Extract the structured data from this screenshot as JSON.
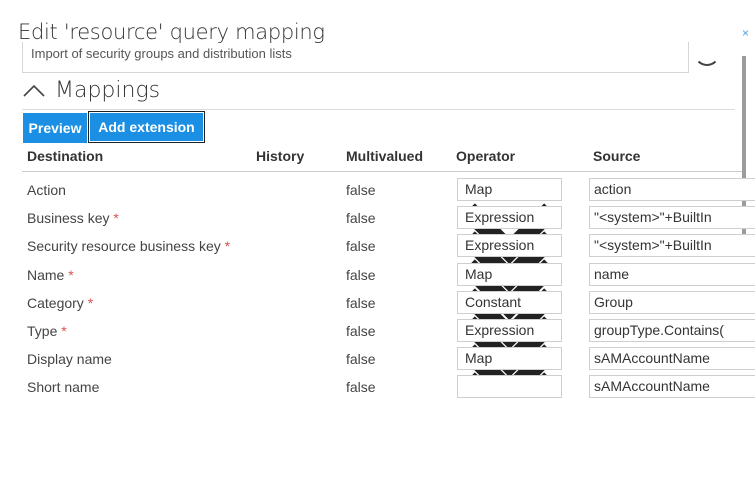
{
  "dialog": {
    "title": "Edit 'resource' query mapping",
    "close_glyph": "×",
    "description": "Import of security groups and distribution lists"
  },
  "section": {
    "title": "Mappings",
    "expanded": true
  },
  "toolbar": {
    "preview_label": "Preview",
    "add_extension_label": "Add extension"
  },
  "table": {
    "headers": {
      "destination": "Destination",
      "history": "History",
      "multivalued": "Multivalued",
      "operator": "Operator",
      "source": "Source"
    },
    "rows": [
      {
        "destination": "Action",
        "required": false,
        "multivalued": "false",
        "operator": "Map",
        "source": "action"
      },
      {
        "destination": "Business key",
        "required": true,
        "multivalued": "false",
        "operator": "Expression",
        "source": "\"<system>\"+BuiltIn"
      },
      {
        "destination": "Security resource business key",
        "required": true,
        "multivalued": "false",
        "operator": "Expression",
        "source": "\"<system>\"+BuiltIn"
      },
      {
        "destination": "Name",
        "required": true,
        "multivalued": "false",
        "operator": "Map",
        "source": "name"
      },
      {
        "destination": "Category",
        "required": true,
        "multivalued": "false",
        "operator": "Constant",
        "source": "Group"
      },
      {
        "destination": "Type",
        "required": true,
        "multivalued": "false",
        "operator": "Expression",
        "source": "groupType.Contains("
      },
      {
        "destination": "Display name",
        "required": false,
        "multivalued": "false",
        "operator": "Map",
        "source": "sAMAccountName"
      },
      {
        "destination": "Short name",
        "required": false,
        "multivalued": "false",
        "operator": "",
        "source": "sAMAccountName"
      }
    ]
  },
  "required_marker": "*",
  "colors": {
    "accent": "#1a8fe3",
    "required": "#d9534f",
    "close": "#4aa3df"
  }
}
